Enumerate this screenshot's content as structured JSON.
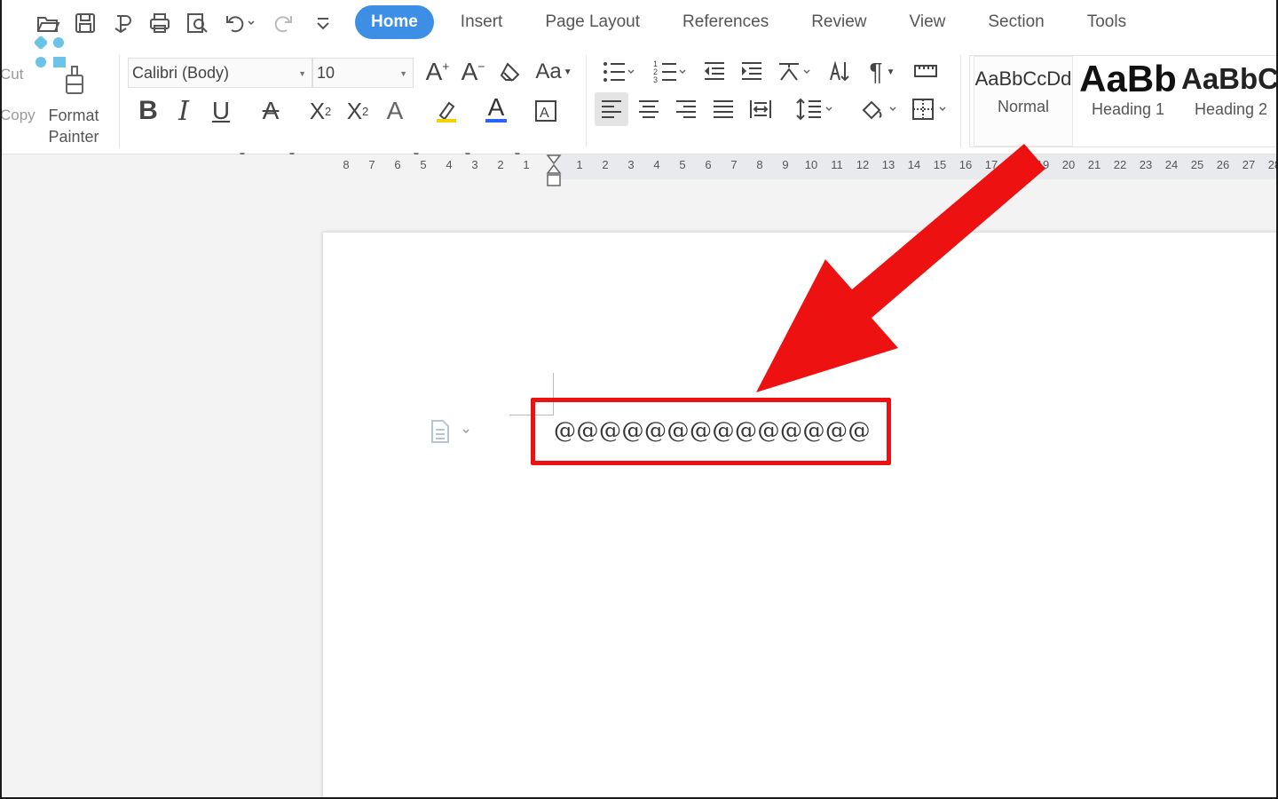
{
  "tabs": [
    {
      "label": "Home",
      "active": true
    },
    {
      "label": "Insert"
    },
    {
      "label": "Page Layout"
    },
    {
      "label": "References"
    },
    {
      "label": "Review"
    },
    {
      "label": "View"
    },
    {
      "label": "Section"
    },
    {
      "label": "Tools"
    }
  ],
  "clipboard": {
    "cut_label": "Cut",
    "copy_label": "Copy",
    "format_painter_line1": "Format",
    "format_painter_line2": "Painter"
  },
  "font": {
    "name": "Calibri (Body)",
    "size": "10"
  },
  "styles": [
    {
      "preview": "AaBbCcDd",
      "name": "Normal"
    },
    {
      "preview": "AaBb",
      "name": "Heading 1"
    },
    {
      "preview": "AaBbC",
      "name": "Heading 2"
    }
  ],
  "ruler": {
    "left_numbers": [
      "8",
      "7",
      "6",
      "5",
      "4",
      "3",
      "2",
      "1"
    ],
    "right_numbers": [
      "1",
      "2",
      "3",
      "4",
      "5",
      "6",
      "7",
      "8",
      "9",
      "10",
      "11",
      "12",
      "13",
      "14",
      "15",
      "16",
      "17",
      "",
      "19",
      "20",
      "21",
      "22",
      "23",
      "24",
      "25",
      "26",
      "27",
      "28"
    ]
  },
  "document": {
    "text": "@@@@@@@@@@@@@@"
  },
  "colors": {
    "accent": "#3d8fe6",
    "highlight": "#ee1111",
    "arrow": "#ee1111"
  },
  "icons": [
    "open-icon",
    "save-icon",
    "print-icon",
    "preview-icon",
    "undo-icon",
    "redo-icon",
    "bold-icon",
    "italic-icon",
    "underline-icon",
    "bullets-icon",
    "numbering-icon",
    "align-left-icon",
    "align-center-icon",
    "align-right-icon",
    "justify-icon",
    "borders-icon",
    "arrow-annotation"
  ]
}
